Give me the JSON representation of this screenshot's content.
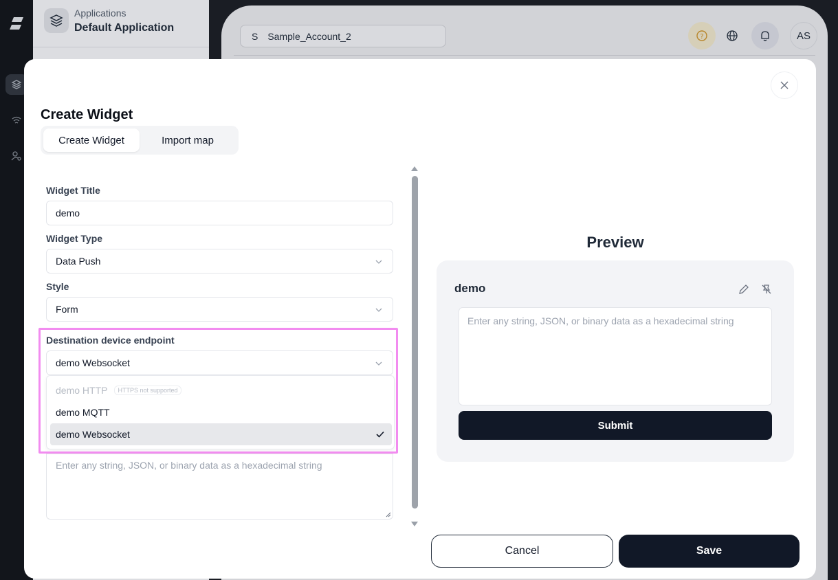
{
  "app": {
    "section_label": "Applications",
    "application_name": "Default Application",
    "account_initial": "S",
    "account_name": "Sample_Account_2",
    "user_initials": "AS"
  },
  "modal": {
    "title": "Create Widget",
    "tabs": [
      {
        "label": "Create Widget",
        "active": true
      },
      {
        "label": "Import map",
        "active": false
      }
    ]
  },
  "form": {
    "widget_title_label": "Widget Title",
    "widget_title_value": "demo",
    "widget_type_label": "Widget Type",
    "widget_type_value": "Data Push",
    "style_label": "Style",
    "style_value": "Form",
    "endpoint_label": "Destination device endpoint",
    "endpoint_value": "demo Websocket",
    "endpoint_options": [
      {
        "label": "demo HTTP",
        "badge": "HTTPS not supported",
        "disabled": true,
        "selected": false
      },
      {
        "label": "demo MQTT",
        "disabled": false,
        "selected": false
      },
      {
        "label": "demo Websocket",
        "disabled": false,
        "selected": true
      }
    ],
    "payload_placeholder": "Enter any string, JSON, or binary data as a hexadecimal string"
  },
  "preview": {
    "heading": "Preview",
    "widget_name": "demo",
    "placeholder": "Enter any string, JSON, or binary data as a hexadecimal string",
    "submit_label": "Submit"
  },
  "footer": {
    "cancel_label": "Cancel",
    "save_label": "Save"
  },
  "colors": {
    "highlight": "#f28cf0",
    "primary_dark": "#111827"
  }
}
